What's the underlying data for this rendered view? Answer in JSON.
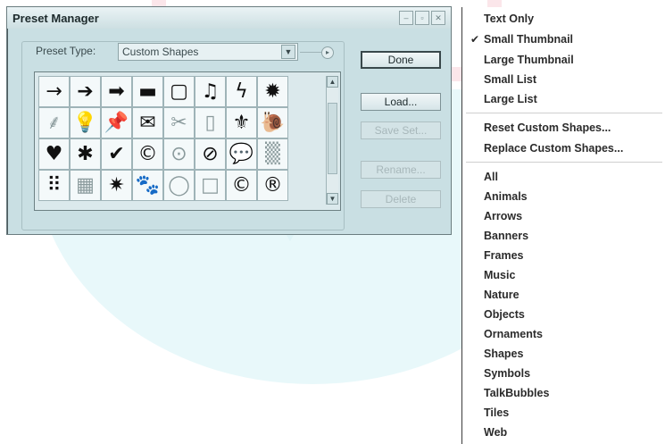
{
  "window": {
    "title": "Preset Manager",
    "preset_type_label": "Preset Type:",
    "preset_type_value": "Custom Shapes",
    "buttons": {
      "done": "Done",
      "load": "Load...",
      "save_set": "Save Set...",
      "rename": "Rename...",
      "delete": "Delete"
    },
    "shapes": [
      {
        "name": "arrow-thin-icon",
        "glyph": "→"
      },
      {
        "name": "arrow-medium-icon",
        "glyph": "➔"
      },
      {
        "name": "arrow-bold-icon",
        "glyph": "➡"
      },
      {
        "name": "banner-icon",
        "glyph": "▬"
      },
      {
        "name": "frame-icon",
        "glyph": "▢"
      },
      {
        "name": "music-notes-icon",
        "glyph": "♫"
      },
      {
        "name": "lightning-icon",
        "glyph": "ϟ"
      },
      {
        "name": "starburst-icon",
        "glyph": "✹"
      },
      {
        "name": "grass-icon",
        "glyph": "⸙",
        "light": true
      },
      {
        "name": "lightbulb-icon",
        "glyph": "💡",
        "light": true
      },
      {
        "name": "thumbtack-icon",
        "glyph": "📌"
      },
      {
        "name": "envelope-icon",
        "glyph": "✉"
      },
      {
        "name": "scissors-icon",
        "glyph": "✂",
        "light": true
      },
      {
        "name": "blank-page-icon",
        "glyph": "▯",
        "light": true
      },
      {
        "name": "fleur-de-lis-icon",
        "glyph": "⚜"
      },
      {
        "name": "snail-icon",
        "glyph": "🐌"
      },
      {
        "name": "heart-icon",
        "glyph": "♥"
      },
      {
        "name": "splat-icon",
        "glyph": "✱"
      },
      {
        "name": "checkmark-icon",
        "glyph": "✔"
      },
      {
        "name": "copyright-icon",
        "glyph": "©"
      },
      {
        "name": "target-icon",
        "glyph": "⊙",
        "light": true
      },
      {
        "name": "no-sign-icon",
        "glyph": "⊘"
      },
      {
        "name": "talk-bubble-icon",
        "glyph": "💬"
      },
      {
        "name": "dotted-tile-icon",
        "glyph": "▒",
        "light": true
      },
      {
        "name": "dot-grid-icon",
        "glyph": "⠿"
      },
      {
        "name": "grid-tile-icon",
        "glyph": "▦",
        "light": true
      },
      {
        "name": "burst-icon",
        "glyph": "✷"
      },
      {
        "name": "paw-print-icon",
        "glyph": "🐾"
      },
      {
        "name": "circle-frame-icon",
        "glyph": "◯",
        "light": true
      },
      {
        "name": "square-frame-icon",
        "glyph": "□",
        "light": true
      },
      {
        "name": "copyright-circle-icon",
        "glyph": "©"
      },
      {
        "name": "registered-icon",
        "glyph": "®"
      }
    ]
  },
  "menu": {
    "view_options": [
      {
        "label": "Text Only",
        "checked": false
      },
      {
        "label": "Small Thumbnail",
        "checked": true
      },
      {
        "label": "Large Thumbnail",
        "checked": false
      },
      {
        "label": "Small List",
        "checked": false
      },
      {
        "label": "Large List",
        "checked": false
      }
    ],
    "actions": [
      "Reset Custom Shapes...",
      "Replace Custom Shapes..."
    ],
    "libraries": [
      "All",
      "Animals",
      "Arrows",
      "Banners",
      "Frames",
      "Music",
      "Nature",
      "Objects",
      "Ornaments",
      "Shapes",
      "Symbols",
      "TalkBubbles",
      "Tiles",
      "Web"
    ]
  }
}
